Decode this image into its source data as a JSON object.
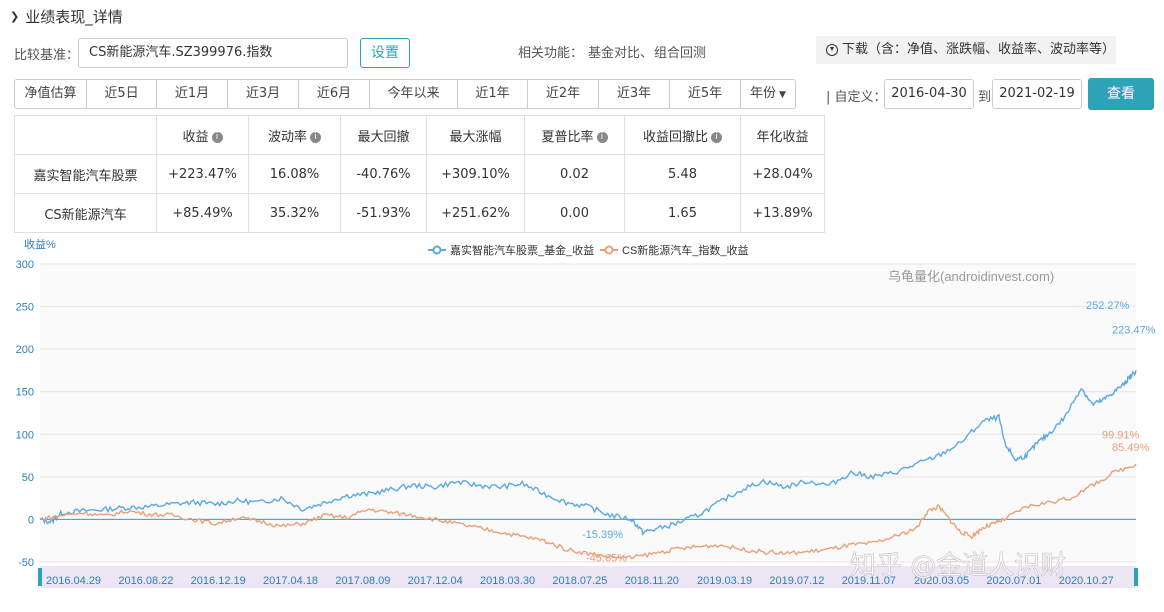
{
  "section": {
    "title": "业绩表现_详情"
  },
  "benchmark": {
    "label": "比较基准：",
    "value": "CS新能源汽车.SZ399976.指数",
    "set_label": "设置"
  },
  "related": {
    "label": "相关功能：",
    "links": [
      "基金对比、",
      "组合回测"
    ]
  },
  "download": {
    "label": "下载（含：净值、涨跌幅、收益率、波动率等）"
  },
  "tabs": [
    "净值估算",
    "近5日",
    "近1月",
    "近3月",
    "近6月",
    "今年以来",
    "近1年",
    "近2年",
    "近3年",
    "近5年",
    "年份"
  ],
  "date_range": {
    "label": "| 自定义：",
    "start": "2016-04-30",
    "to_label": "到",
    "end": "2021-02-19",
    "query_label": "查看"
  },
  "stats_table": {
    "headers": [
      "收益",
      "波动率",
      "最大回撤",
      "最大涨幅",
      "夏普比率",
      "收益回撤比",
      "年化收益"
    ],
    "info_headers": [
      true,
      true,
      false,
      false,
      true,
      true,
      false
    ],
    "rows": [
      {
        "name": "嘉实智能汽车股票",
        "cells": [
          "+223.47%",
          "16.08%",
          "-40.76%",
          "+309.10%",
          "0.02",
          "5.48",
          "+28.04%"
        ],
        "tones": [
          "pos",
          "",
          "neg",
          "pos",
          "",
          "",
          "pos"
        ]
      },
      {
        "name": "CS新能源汽车",
        "cells": [
          "+85.49%",
          "35.32%",
          "-51.93%",
          "+251.62%",
          "0.00",
          "1.65",
          "+13.89%"
        ],
        "tones": [
          "pos",
          "",
          "neg",
          "pos",
          "",
          "",
          "pos"
        ]
      }
    ]
  },
  "watermark": {
    "text": "乌龟量化(androidinvest.com)",
    "zhihu": "知乎 @金道人识财"
  },
  "colors": {
    "fund": "#5aa9e0",
    "index": "#e8a07a",
    "accent": "#2ea3b8"
  },
  "chart_data": {
    "type": "line",
    "ylabel": "收益%",
    "ylim": [
      -50,
      300
    ],
    "yticks": [
      300,
      250,
      200,
      150,
      100,
      50,
      0,
      -50
    ],
    "x_tick_labels": [
      "2016.04.29",
      "2016.08.22",
      "2016.12.19",
      "2017.04.18",
      "2017.08.09",
      "2017.12.04",
      "2018.03.30",
      "2018.07.25",
      "2018.11.20",
      "2019.03.19",
      "2019.07.12",
      "2019.11.07",
      "2020.03.05",
      "2020.07.01",
      "2020.10.27"
    ],
    "x_tick_positions": [
      0,
      0.066,
      0.132,
      0.198,
      0.264,
      0.33,
      0.396,
      0.462,
      0.528,
      0.594,
      0.66,
      0.726,
      0.792,
      0.858,
      0.924
    ],
    "series": [
      {
        "name": "嘉实智能汽车股票_基金_收益",
        "points": [
          [
            0,
            0
          ],
          [
            0.01,
            -3
          ],
          [
            0.02,
            8
          ],
          [
            0.04,
            10
          ],
          [
            0.06,
            12
          ],
          [
            0.08,
            14
          ],
          [
            0.1,
            15
          ],
          [
            0.12,
            18
          ],
          [
            0.14,
            20
          ],
          [
            0.16,
            18
          ],
          [
            0.18,
            22
          ],
          [
            0.2,
            20
          ],
          [
            0.22,
            25
          ],
          [
            0.24,
            12
          ],
          [
            0.26,
            20
          ],
          [
            0.28,
            28
          ],
          [
            0.3,
            30
          ],
          [
            0.32,
            35
          ],
          [
            0.34,
            40
          ],
          [
            0.36,
            38
          ],
          [
            0.38,
            44
          ],
          [
            0.4,
            40
          ],
          [
            0.42,
            38
          ],
          [
            0.44,
            42
          ],
          [
            0.46,
            30
          ],
          [
            0.48,
            20
          ],
          [
            0.5,
            15
          ],
          [
            0.52,
            5
          ],
          [
            0.54,
            0
          ],
          [
            0.55,
            -15
          ],
          [
            0.56,
            -12
          ],
          [
            0.58,
            -5
          ],
          [
            0.6,
            5
          ],
          [
            0.62,
            20
          ],
          [
            0.64,
            35
          ],
          [
            0.66,
            45
          ],
          [
            0.68,
            38
          ],
          [
            0.7,
            45
          ],
          [
            0.72,
            40
          ],
          [
            0.74,
            55
          ],
          [
            0.76,
            50
          ],
          [
            0.78,
            55
          ],
          [
            0.8,
            65
          ],
          [
            0.82,
            75
          ],
          [
            0.84,
            90
          ],
          [
            0.86,
            115
          ],
          [
            0.875,
            120
          ],
          [
            0.88,
            90
          ],
          [
            0.89,
            70
          ],
          [
            0.9,
            75
          ],
          [
            0.91,
            90
          ],
          [
            0.92,
            100
          ],
          [
            0.935,
            120
          ],
          [
            0.95,
            155
          ],
          [
            0.96,
            135
          ],
          [
            0.97,
            140
          ],
          [
            0.98,
            150
          ],
          [
            0.99,
            160
          ],
          [
            1.0,
            175
          ],
          [
            0.993,
            165
          ]
        ],
        "end_label": "223.47%",
        "peak_label": "252.27%",
        "min_label": "-15.39%"
      },
      {
        "name": "CS新能源汽车_指数_收益",
        "points": [
          [
            0,
            0
          ],
          [
            0.02,
            5
          ],
          [
            0.04,
            8
          ],
          [
            0.06,
            4
          ],
          [
            0.08,
            10
          ],
          [
            0.1,
            6
          ],
          [
            0.12,
            5
          ],
          [
            0.14,
            0
          ],
          [
            0.16,
            -5
          ],
          [
            0.18,
            2
          ],
          [
            0.2,
            -2
          ],
          [
            0.22,
            -8
          ],
          [
            0.24,
            -5
          ],
          [
            0.26,
            5
          ],
          [
            0.28,
            2
          ],
          [
            0.3,
            12
          ],
          [
            0.32,
            8
          ],
          [
            0.34,
            5
          ],
          [
            0.36,
            0
          ],
          [
            0.38,
            -5
          ],
          [
            0.4,
            -10
          ],
          [
            0.42,
            -15
          ],
          [
            0.44,
            -20
          ],
          [
            0.46,
            -25
          ],
          [
            0.48,
            -35
          ],
          [
            0.5,
            -40
          ],
          [
            0.52,
            -44
          ],
          [
            0.54,
            -45
          ],
          [
            0.56,
            -40
          ],
          [
            0.58,
            -35
          ],
          [
            0.6,
            -32
          ],
          [
            0.62,
            -30
          ],
          [
            0.64,
            -35
          ],
          [
            0.66,
            -38
          ],
          [
            0.68,
            -40
          ],
          [
            0.7,
            -38
          ],
          [
            0.72,
            -35
          ],
          [
            0.74,
            -30
          ],
          [
            0.76,
            -28
          ],
          [
            0.78,
            -20
          ],
          [
            0.8,
            -10
          ],
          [
            0.81,
            10
          ],
          [
            0.82,
            15
          ],
          [
            0.83,
            0
          ],
          [
            0.84,
            -15
          ],
          [
            0.85,
            -20
          ],
          [
            0.86,
            -10
          ],
          [
            0.87,
            -5
          ],
          [
            0.88,
            0
          ],
          [
            0.9,
            15
          ],
          [
            0.92,
            20
          ],
          [
            0.94,
            25
          ],
          [
            0.96,
            40
          ],
          [
            0.98,
            55
          ],
          [
            1.0,
            65
          ]
        ],
        "end_label": "85.49%",
        "peak_label": "99.91%",
        "min_label": "-45.65%"
      }
    ],
    "legend": "top-center"
  }
}
